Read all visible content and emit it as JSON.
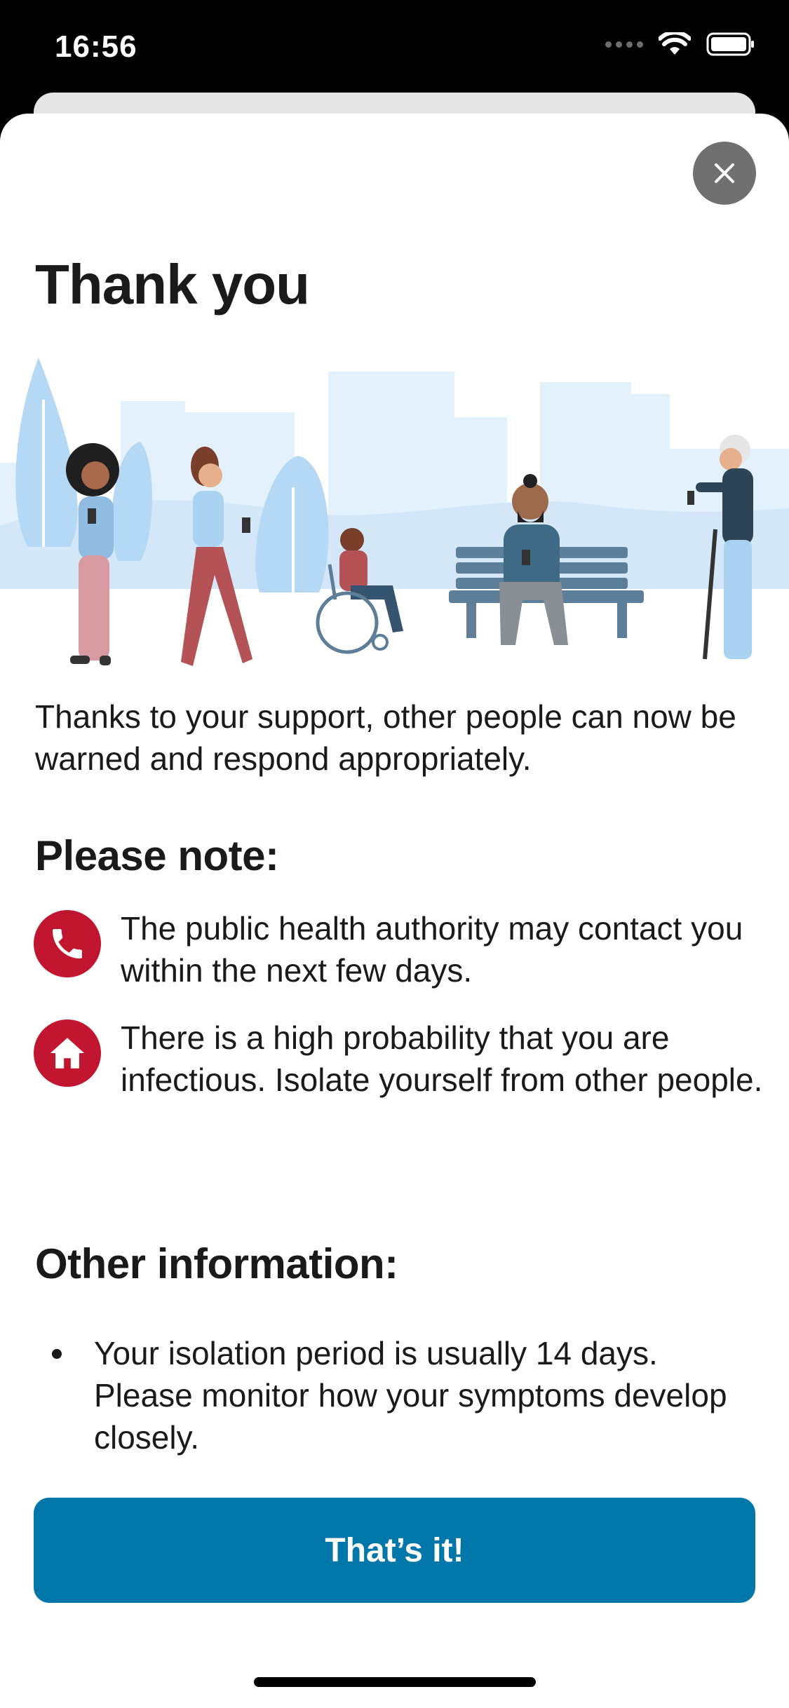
{
  "status_bar": {
    "time": "16:56"
  },
  "sheet": {
    "close_icon": "close-icon",
    "title": "Thank you",
    "intro": "Thanks to your support, other people can now be warned and respond appropriately.",
    "please_note": {
      "heading": "Please note:",
      "items": [
        {
          "icon": "phone-icon",
          "text": "The public health authority may contact you within the next few days."
        },
        {
          "icon": "home-icon",
          "text": "There is a high probability that you are infectious. Isolate yourself from other people."
        }
      ]
    },
    "other_information": {
      "heading": "Other information:",
      "items": [
        {
          "text": "Your isolation period is usually 14 days. Please monitor how your symptoms develop closely."
        }
      ]
    },
    "button_label": "That’s it!"
  },
  "colors": {
    "accent_red": "#c2152f",
    "button_blue": "#0077a8",
    "illustration_light_blue": "#d9ecfb"
  }
}
